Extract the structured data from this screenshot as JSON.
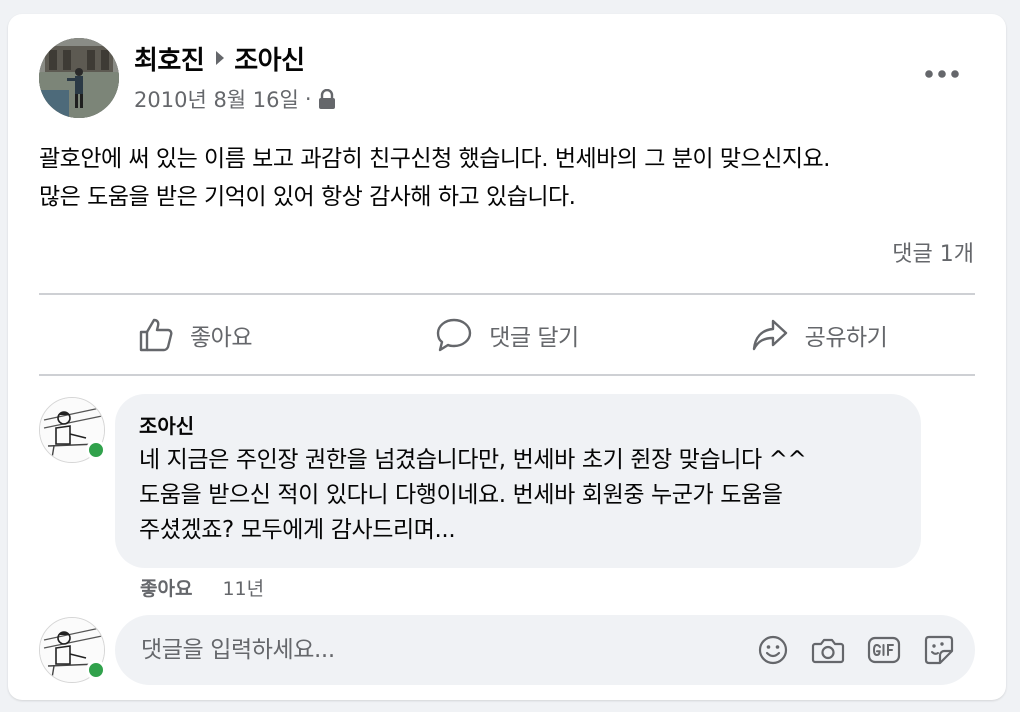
{
  "post": {
    "author": "최호진",
    "target": "조아신",
    "date": "2010년 8월 16일",
    "dot": "·",
    "privacy_icon": "lock-icon",
    "text": "괄호안에 써 있는 이름 보고 과감히 친구신청 했습니다. 번세바의 그 분이 맞으신지요.\n많은 도움을 받은 기억이 있어 항상 감사해 하고 있습니다.",
    "comment_count": "댓글 1개"
  },
  "actions": {
    "like": "좋아요",
    "comment": "댓글 달기",
    "share": "공유하기"
  },
  "comment": {
    "author": "조아신",
    "text": "네 지금은 주인장 권한을 넘겼습니다만, 번세바 초기 쥔장 맞습니다 ^^\n도움을 받으신 적이 있다니 다행이네요. 번세바 회원중 누군가 도움을\n주셨겠죠? 모두에게 감사드리며...",
    "like_label": "좋아요",
    "age": "11년"
  },
  "composer": {
    "placeholder": "댓글을 입력하세요...",
    "icons": [
      "emoji-icon",
      "camera-icon",
      "gif-icon",
      "sticker-icon"
    ]
  },
  "colors": {
    "background": "#f0f2f5",
    "card": "#ffffff",
    "secondary_text": "#65676b",
    "online": "#31a24c"
  }
}
